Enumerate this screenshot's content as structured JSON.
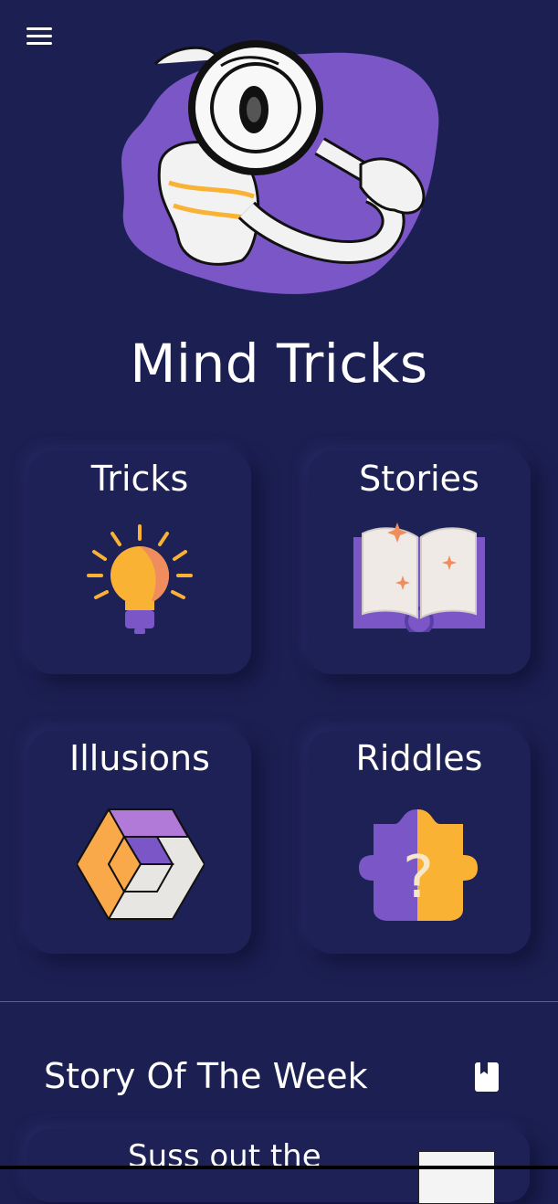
{
  "app": {
    "title": "Mind Tricks"
  },
  "menu": {
    "icon": "hamburger-menu-icon"
  },
  "categories": [
    {
      "label": "Tricks",
      "icon": "lightbulb-icon"
    },
    {
      "label": "Stories",
      "icon": "open-book-icon"
    },
    {
      "label": "Illusions",
      "icon": "impossible-cube-icon"
    },
    {
      "label": "Riddles",
      "icon": "question-head-icon"
    }
  ],
  "story_of_week": {
    "heading": "Story Of The Week",
    "icon": "book-icon",
    "story_title": "Suss out the"
  },
  "colors": {
    "background": "#1c1f52",
    "card": "#1d2156",
    "purple": "#7b56c6",
    "orange": "#f9b233",
    "salmon": "#f08d5f"
  }
}
